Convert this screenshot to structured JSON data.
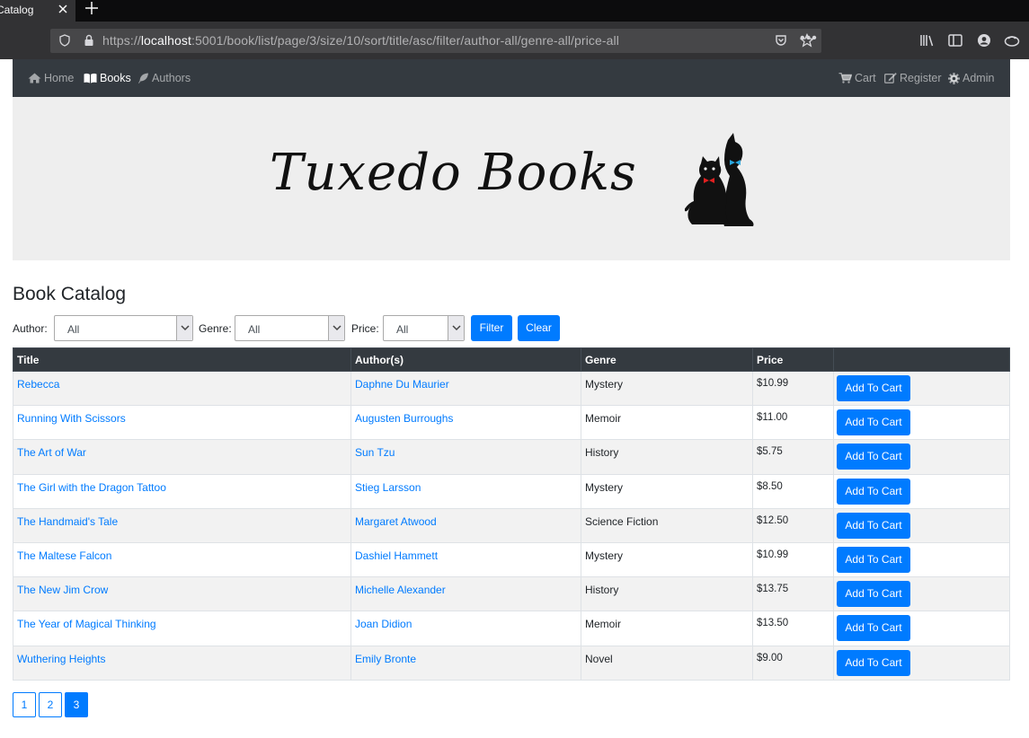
{
  "browser": {
    "tab_title": "Catalog",
    "url_scheme": "https://",
    "url_host": "localhost",
    "url_rest": ":5001/book/list/page/3/size/10/sort/title/asc/filter/author-all/genre-all/price-all",
    "url_dots": "•••"
  },
  "nav": {
    "left": [
      {
        "label": "Home",
        "icon": "home-icon"
      },
      {
        "label": "Books",
        "icon": "book-icon"
      },
      {
        "label": "Authors",
        "icon": "feather-icon"
      }
    ],
    "right": [
      {
        "label": "Cart",
        "icon": "cart-icon"
      },
      {
        "label": "Register",
        "icon": "edit-icon"
      },
      {
        "label": "Admin",
        "icon": "gear-icon"
      }
    ]
  },
  "banner": {
    "logo_text": "Tuxedo Books"
  },
  "catalog": {
    "title": "Book Catalog",
    "filters": {
      "author_label": "Author:",
      "author_value": "All",
      "genre_label": "Genre:",
      "genre_value": "All",
      "price_label": "Price:",
      "price_value": "All",
      "filter_button": "Filter",
      "clear_button": "Clear"
    },
    "columns": [
      "Title",
      "Author(s)",
      "Genre",
      "Price",
      ""
    ],
    "add_button": "Add To Cart",
    "rows": [
      {
        "title": "Rebecca",
        "author": "Daphne Du Maurier",
        "genre": "Mystery",
        "price": "$10.99"
      },
      {
        "title": "Running With Scissors",
        "author": "Augusten Burroughs",
        "genre": "Memoir",
        "price": "$11.00"
      },
      {
        "title": "The Art of War",
        "author": "Sun Tzu",
        "genre": "History",
        "price": "$5.75"
      },
      {
        "title": "The Girl with the Dragon Tattoo",
        "author": "Stieg Larsson",
        "genre": "Mystery",
        "price": "$8.50"
      },
      {
        "title": "The Handmaid's Tale",
        "author": "Margaret Atwood",
        "genre": "Science Fiction",
        "price": "$12.50"
      },
      {
        "title": "The Maltese Falcon",
        "author": "Dashiel Hammett",
        "genre": "Mystery",
        "price": "$10.99"
      },
      {
        "title": "The New Jim Crow",
        "author": "Michelle Alexander",
        "genre": "History",
        "price": "$13.75"
      },
      {
        "title": "The Year of Magical Thinking",
        "author": "Joan Didion",
        "genre": "Memoir",
        "price": "$13.50"
      },
      {
        "title": "Wuthering Heights",
        "author": "Emily Bronte",
        "genre": "Novel",
        "price": "$9.00"
      }
    ]
  },
  "pagination": {
    "pages": [
      "1",
      "2",
      "3"
    ],
    "current": "3"
  },
  "colors": {
    "primary": "#007bff",
    "navbar": "#343a40",
    "banner_bg": "#eeeeee"
  }
}
